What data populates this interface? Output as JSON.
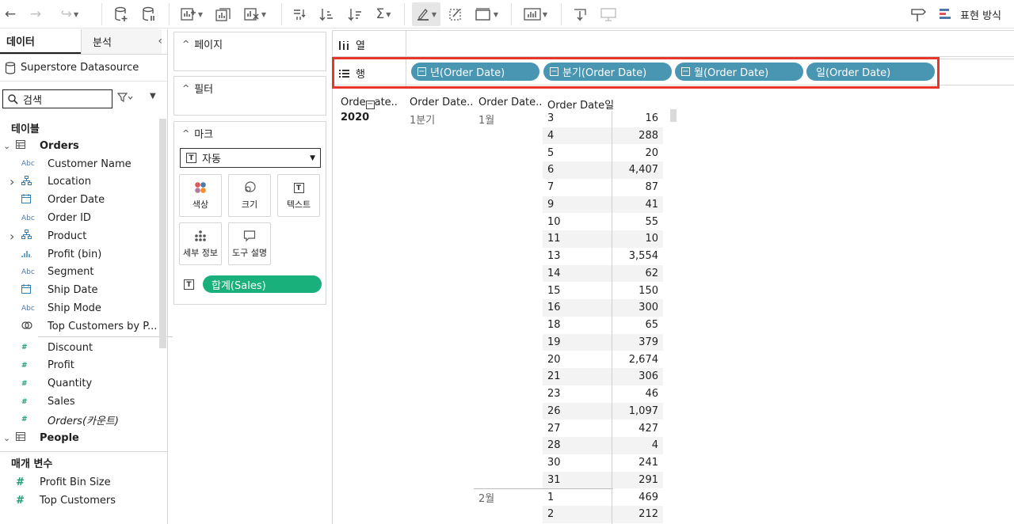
{
  "presentation_label": "표현 방식",
  "left": {
    "tab_data": "데이터",
    "tab_analysis": "분석",
    "datasource": "Superstore Datasource",
    "search_placeholder": "검색",
    "tables_title": "테이블",
    "orders_group": "Orders",
    "fields": [
      {
        "name": "Customer Name",
        "type": "abc",
        "expandable": false
      },
      {
        "name": "Location",
        "type": "hier",
        "expandable": true
      },
      {
        "name": "Order Date",
        "type": "date",
        "expandable": false
      },
      {
        "name": "Order ID",
        "type": "abc",
        "expandable": false
      },
      {
        "name": "Product",
        "type": "hier",
        "expandable": true
      },
      {
        "name": "Profit (bin)",
        "type": "bin",
        "expandable": false
      },
      {
        "name": "Segment",
        "type": "abc",
        "expandable": false
      },
      {
        "name": "Ship Date",
        "type": "date",
        "expandable": false
      },
      {
        "name": "Ship Mode",
        "type": "abc",
        "expandable": false
      },
      {
        "name": "Top Customers by P...",
        "type": "set",
        "expandable": false
      }
    ],
    "measures": [
      "Discount",
      "Profit",
      "Quantity",
      "Sales",
      "Orders(카운트)"
    ],
    "people_group": "People",
    "params_title": "매개 변수",
    "params": [
      "Profit Bin Size",
      "Top Customers"
    ]
  },
  "cards": {
    "pages": "페이지",
    "filters": "필터",
    "marks": "마크",
    "mark_type": "자동",
    "buttons": {
      "color": "색상",
      "size": "크기",
      "text": "텍스트",
      "detail": "세부 정보",
      "tooltip": "도구 설명"
    },
    "sales_pill": "합계(Sales)"
  },
  "shelves": {
    "columns_label": "열",
    "rows_label": "행",
    "row_pills": [
      "년(Order Date)",
      "분기(Order Date)",
      "월(Order Date)",
      "일(Order Date)"
    ]
  },
  "table": {
    "headers": [
      "Orde",
      "ate..",
      "Order Date..",
      "Order Date..",
      "Order Date일"
    ],
    "year": "2020",
    "quarter": "1분기",
    "month1": "1월",
    "month2": "2월",
    "rows": [
      {
        "day": "3",
        "value": "16"
      },
      {
        "day": "4",
        "value": "288"
      },
      {
        "day": "5",
        "value": "20"
      },
      {
        "day": "6",
        "value": "4,407"
      },
      {
        "day": "7",
        "value": "87"
      },
      {
        "day": "9",
        "value": "41"
      },
      {
        "day": "10",
        "value": "55"
      },
      {
        "day": "11",
        "value": "10"
      },
      {
        "day": "13",
        "value": "3,554"
      },
      {
        "day": "14",
        "value": "62"
      },
      {
        "day": "15",
        "value": "150"
      },
      {
        "day": "16",
        "value": "300"
      },
      {
        "day": "18",
        "value": "65"
      },
      {
        "day": "19",
        "value": "379"
      },
      {
        "day": "20",
        "value": "2,674"
      },
      {
        "day": "21",
        "value": "306"
      },
      {
        "day": "23",
        "value": "46"
      },
      {
        "day": "26",
        "value": "1,097"
      },
      {
        "day": "27",
        "value": "427"
      },
      {
        "day": "28",
        "value": "4"
      },
      {
        "day": "30",
        "value": "241"
      },
      {
        "day": "31",
        "value": "291"
      },
      {
        "day": "1",
        "value": "469"
      },
      {
        "day": "2",
        "value": "212"
      }
    ]
  }
}
